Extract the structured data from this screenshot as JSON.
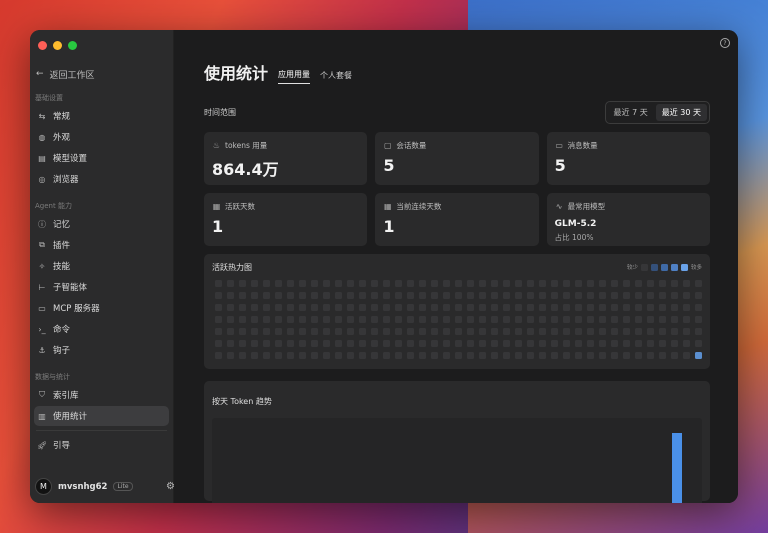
{
  "sidebar": {
    "back_label": "返回工作区",
    "sections": [
      {
        "title": "基础设置",
        "items": [
          {
            "label": "常规",
            "icon": "sliders-icon"
          },
          {
            "label": "外观",
            "icon": "palette-icon"
          },
          {
            "label": "模型设置",
            "icon": "model-icon"
          },
          {
            "label": "浏览器",
            "icon": "browser-icon"
          }
        ]
      },
      {
        "title": "Agent 能力",
        "items": [
          {
            "label": "记忆",
            "icon": "memory-icon"
          },
          {
            "label": "插件",
            "icon": "plugin-icon"
          },
          {
            "label": "技能",
            "icon": "skill-icon"
          },
          {
            "label": "子智能体",
            "icon": "subagent-icon"
          },
          {
            "label": "MCP 服务器",
            "icon": "server-icon"
          },
          {
            "label": "命令",
            "icon": "terminal-icon"
          },
          {
            "label": "钩子",
            "icon": "anchor-icon"
          }
        ]
      },
      {
        "title": "数据与统计",
        "items": [
          {
            "label": "索引库",
            "icon": "shield-icon"
          },
          {
            "label": "使用统计",
            "icon": "chart-icon",
            "active": true
          }
        ]
      }
    ],
    "guide_label": "引导",
    "user": {
      "initial": "M",
      "name": "mvsnhg62",
      "badge": "Lite"
    }
  },
  "main": {
    "title": "使用统计",
    "tabs": [
      {
        "label": "应用用量",
        "active": true
      },
      {
        "label": "个人套餐",
        "active": false
      }
    ],
    "range": {
      "label": "时间范围",
      "options": [
        {
          "label": "最近 7 天",
          "active": false
        },
        {
          "label": "最近 30 天",
          "active": true
        }
      ]
    },
    "cards": [
      {
        "label": "tokens 用量",
        "value": "864.4万",
        "icon": "flame-icon"
      },
      {
        "label": "会话数量",
        "value": "5",
        "icon": "chat-icon"
      },
      {
        "label": "消息数量",
        "value": "5",
        "icon": "message-icon"
      },
      {
        "label": "活跃天数",
        "value": "1",
        "icon": "calendar-icon"
      },
      {
        "label": "当前连续天数",
        "value": "1",
        "icon": "calendar-icon"
      },
      {
        "label": "最常用模型",
        "value": "GLM-5.2",
        "sub": "占比 100%",
        "icon": "activity-icon"
      }
    ],
    "heatmap": {
      "title": "活跃热力图",
      "legend_less": "较少",
      "legend_more": "较多",
      "legend_colors": [
        "#363638",
        "#34507a",
        "#3f6aa6",
        "#4f80c4",
        "#6aa2e8"
      ],
      "active_days": 1
    },
    "trend": {
      "title": "按天 Token 趋势"
    }
  }
}
